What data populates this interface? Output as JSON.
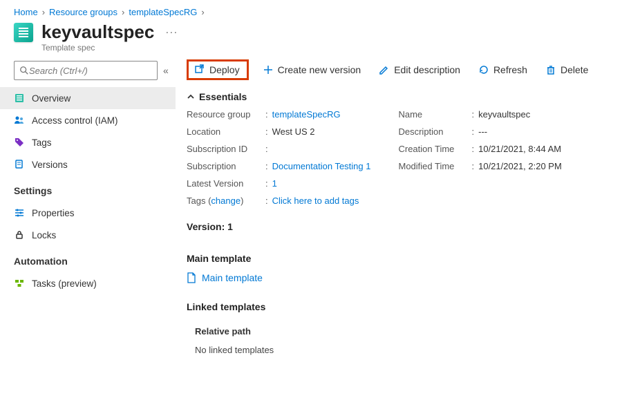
{
  "breadcrumb": {
    "items": [
      {
        "label": "Home"
      },
      {
        "label": "Resource groups"
      },
      {
        "label": "templateSpecRG"
      }
    ]
  },
  "header": {
    "title": "keyvaultspec",
    "subtitle": "Template spec"
  },
  "sidebar": {
    "search_placeholder": "Search (Ctrl+/)",
    "items": [
      {
        "label": "Overview",
        "icon": "overview"
      },
      {
        "label": "Access control (IAM)",
        "icon": "iam"
      },
      {
        "label": "Tags",
        "icon": "tags"
      },
      {
        "label": "Versions",
        "icon": "versions"
      }
    ],
    "sections": [
      {
        "title": "Settings",
        "items": [
          {
            "label": "Properties",
            "icon": "properties"
          },
          {
            "label": "Locks",
            "icon": "locks"
          }
        ]
      },
      {
        "title": "Automation",
        "items": [
          {
            "label": "Tasks (preview)",
            "icon": "tasks"
          }
        ]
      }
    ]
  },
  "toolbar": {
    "deploy": "Deploy",
    "create_version": "Create new version",
    "edit_description": "Edit description",
    "refresh": "Refresh",
    "delete": "Delete"
  },
  "essentials": {
    "title": "Essentials",
    "left": {
      "resource_group_label": "Resource group",
      "resource_group_value": "templateSpecRG",
      "location_label": "Location",
      "location_value": "West US 2",
      "subscription_id_label": "Subscription ID",
      "subscription_id_value": "",
      "subscription_label": "Subscription",
      "subscription_value": "Documentation Testing 1",
      "latest_version_label": "Latest Version",
      "latest_version_value": "1",
      "tags_label": "Tags",
      "tags_change": "change",
      "tags_value": "Click here to add tags"
    },
    "right": {
      "name_label": "Name",
      "name_value": "keyvaultspec",
      "description_label": "Description",
      "description_value": "---",
      "creation_label": "Creation Time",
      "creation_value": "10/21/2021, 8:44 AM",
      "modified_label": "Modified Time",
      "modified_value": "10/21/2021, 2:20 PM"
    }
  },
  "content": {
    "version_heading": "Version: 1",
    "main_template_heading": "Main template",
    "main_template_link": "Main template",
    "linked_heading": "Linked templates",
    "linked_col_header": "Relative path",
    "linked_empty": "No linked templates"
  }
}
